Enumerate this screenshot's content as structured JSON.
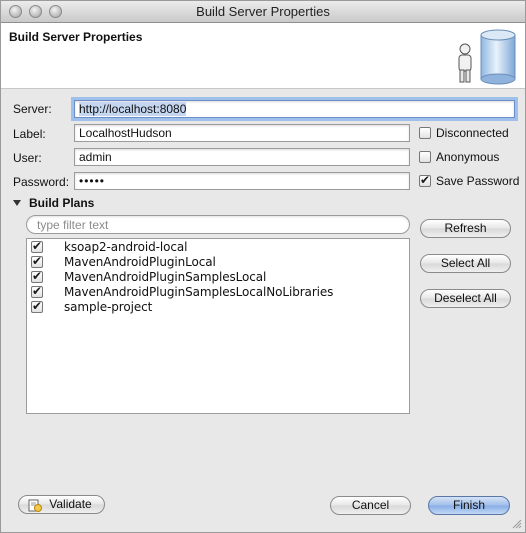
{
  "window": {
    "title": "Build Server Properties"
  },
  "header": {
    "title": "Build Server Properties",
    "art_icon": "server-user-icon"
  },
  "form": {
    "server": {
      "label": "Server:",
      "value": "http://localhost:8080"
    },
    "label": {
      "label": "Label:",
      "value": "LocalhostHudson"
    },
    "user": {
      "label": "User:",
      "value": "admin"
    },
    "password": {
      "label": "Password:",
      "value": "•••••"
    }
  },
  "options": {
    "disconnected": {
      "label": "Disconnected",
      "checked": false
    },
    "anonymous": {
      "label": "Anonymous",
      "checked": false
    },
    "save_password": {
      "label": "Save Password",
      "checked": true
    }
  },
  "build_plans": {
    "title": "Build Plans",
    "filter_placeholder": "type filter text",
    "items": [
      {
        "name": "ksoap2-android-local",
        "checked": true
      },
      {
        "name": "MavenAndroidPluginLocal",
        "checked": true
      },
      {
        "name": "MavenAndroidPluginSamplesLocal",
        "checked": true
      },
      {
        "name": "MavenAndroidPluginSamplesLocalNoLibraries",
        "checked": true
      },
      {
        "name": "sample-project",
        "checked": true
      }
    ],
    "buttons": {
      "refresh": "Refresh",
      "select_all": "Select All",
      "deselect_all": "Deselect All"
    }
  },
  "footer": {
    "validate": "Validate",
    "cancel": "Cancel",
    "finish": "Finish"
  }
}
